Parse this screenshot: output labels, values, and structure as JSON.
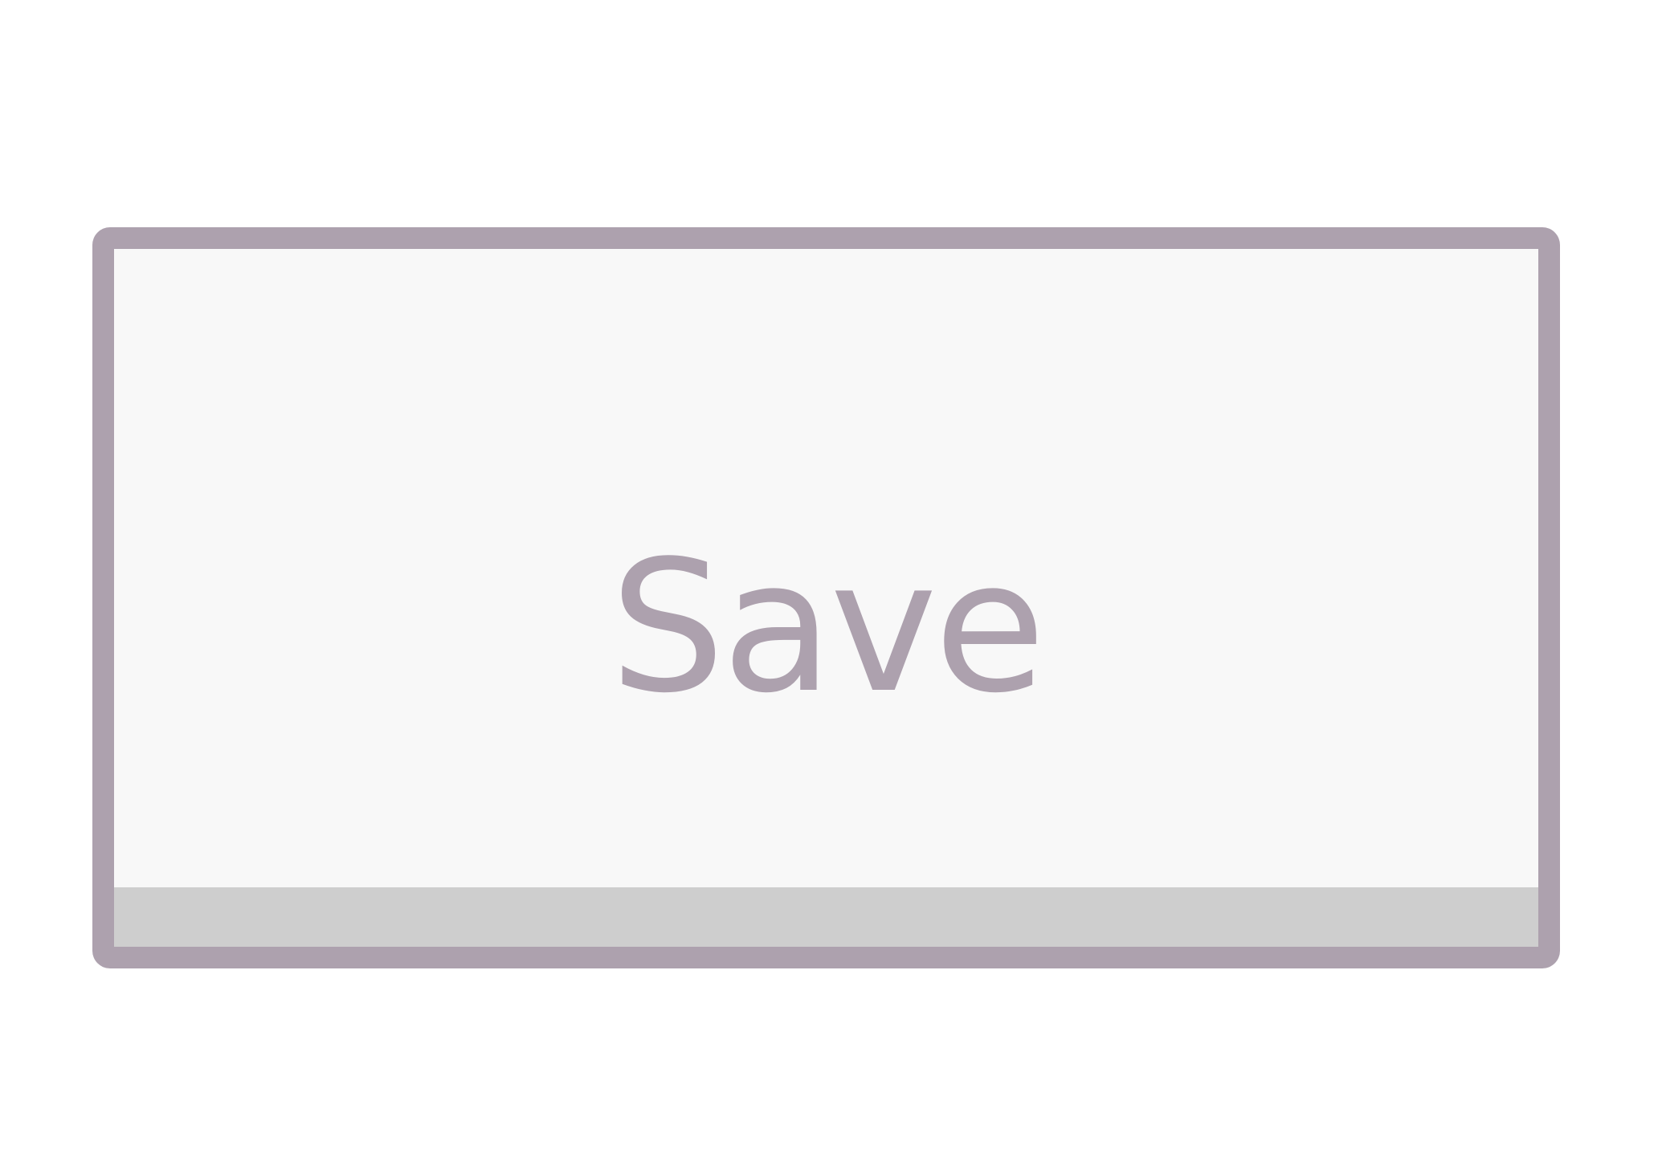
{
  "button": {
    "label": "Save"
  },
  "colors": {
    "border": "#ada1ae",
    "text": "#ada1ae",
    "face": "#f8f8f8",
    "bottom_strip": "#cecece",
    "page_background": "#ffffff"
  }
}
